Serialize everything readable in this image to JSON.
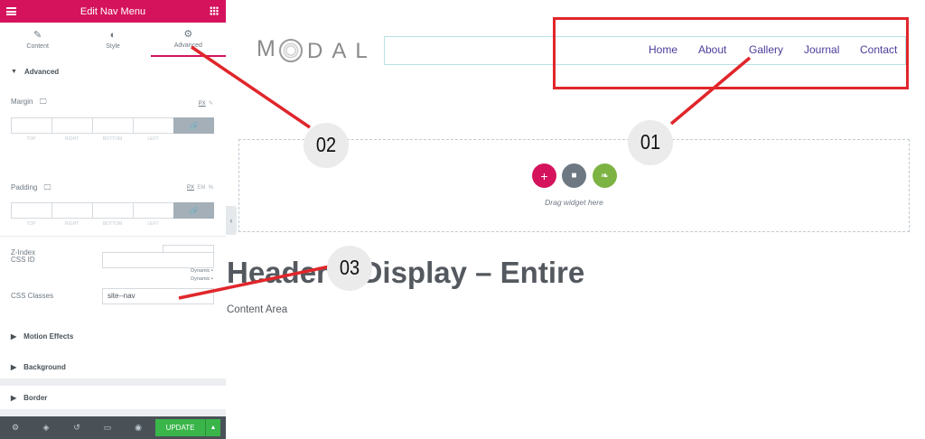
{
  "panel": {
    "title": "Edit Nav Menu",
    "tabs": [
      {
        "label": "Content",
        "icon": "pencil-icon"
      },
      {
        "label": "Style",
        "icon": "contrast-icon"
      },
      {
        "label": "Advanced",
        "icon": "gear-icon",
        "active": true
      }
    ],
    "advanced": {
      "heading": "Advanced",
      "margin": {
        "label": "Margin",
        "unit_px": "PX",
        "unit_em": "%",
        "sides": [
          "TOP",
          "RIGHT",
          "BOTTOM",
          "LEFT"
        ]
      },
      "padding": {
        "label": "Padding",
        "unit_px": "PX",
        "unit_em": "EM",
        "unit_pct": "%",
        "sides": [
          "TOP",
          "RIGHT",
          "BOTTOM",
          "LEFT"
        ]
      },
      "z_index": {
        "label": "Z-Index",
        "value": "",
        "dynamic": "Dynamic"
      },
      "css_id": {
        "label": "CSS ID",
        "value": "",
        "dynamic": "Dynamic"
      },
      "css_classes": {
        "label": "CSS Classes",
        "value": "site--nav"
      }
    },
    "sections": [
      "Motion Effects",
      "Background",
      "Border"
    ],
    "footer": {
      "update_label": "UPDATE"
    }
  },
  "preview": {
    "logo_first": "M",
    "logo_rest": "DAL",
    "nav": [
      "Home",
      "About",
      "Gallery",
      "Journal",
      "Contact"
    ],
    "drop_text": "Drag widget here",
    "heading": "Header – Display – Entire",
    "subheading": "Content Area"
  },
  "annotations": {
    "one": "01",
    "two": "02",
    "three": "03"
  },
  "colors": {
    "brand": "#d5135d",
    "annotation": "#e0262b",
    "nav_link": "#4d3c9a",
    "update": "#39b54a"
  }
}
